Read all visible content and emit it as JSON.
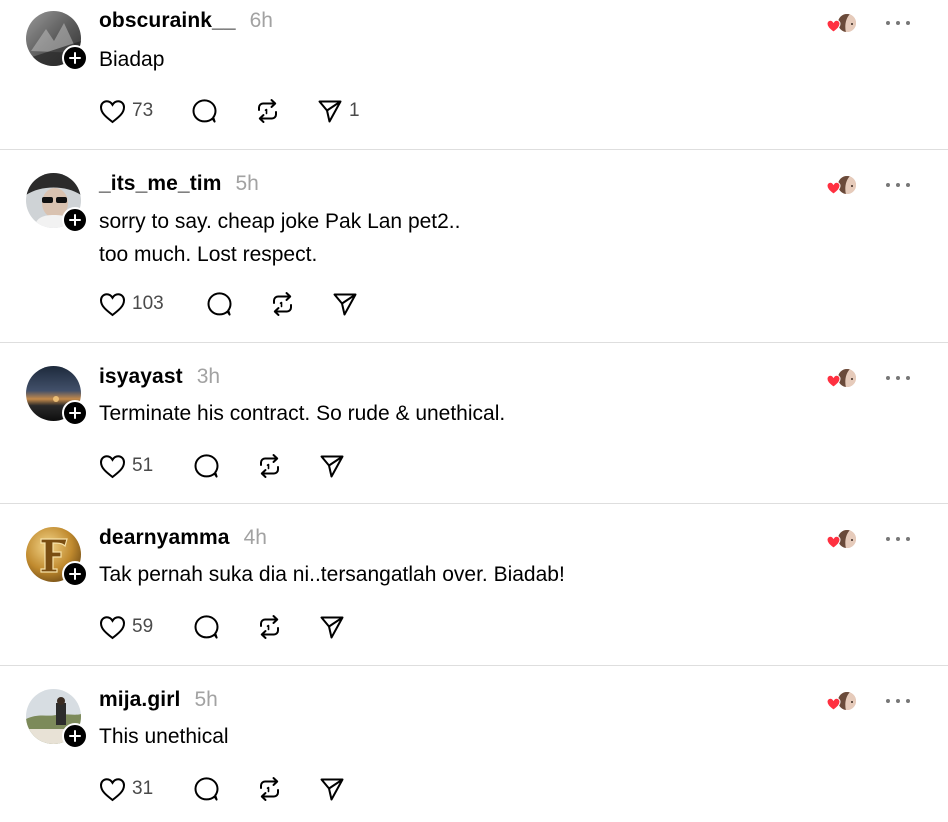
{
  "colors": {
    "text": "#000000",
    "muted": "#a2a2a2",
    "divider": "#dedede",
    "heart_reaction": "#ff3040",
    "icon": "#000000"
  },
  "posts": [
    {
      "username": "obscuraink__",
      "timestamp": "6h",
      "lines": [
        "Biadap"
      ],
      "likes": "73",
      "shares": "1",
      "avatar": "gray-texture",
      "reactor_icon": "heart-reaction-icon"
    },
    {
      "username": "_its_me_tim",
      "timestamp": "5h",
      "lines": [
        "sorry to say. cheap joke Pak Lan pet2..",
        "too much. Lost respect."
      ],
      "likes": "103",
      "shares": "",
      "avatar": "person-sunglasses",
      "reactor_icon": "heart-reaction-icon"
    },
    {
      "username": "isyayast",
      "timestamp": "3h",
      "lines": [
        "Terminate his contract. So rude & unethical."
      ],
      "likes": "51",
      "shares": "",
      "avatar": "sunset",
      "reactor_icon": "heart-reaction-icon"
    },
    {
      "username": "dearnyamma",
      "timestamp": "4h",
      "lines": [
        "Tak pernah suka dia ni..tersangatlah over. Biadab!"
      ],
      "likes": "59",
      "shares": "",
      "avatar": "gold-letter-f",
      "reactor_icon": "heart-reaction-icon"
    },
    {
      "username": "mija.girl",
      "timestamp": "5h",
      "lines": [
        "This unethical"
      ],
      "likes": "31",
      "shares": "",
      "avatar": "outdoor-scene",
      "reactor_icon": "heart-reaction-icon"
    }
  ]
}
